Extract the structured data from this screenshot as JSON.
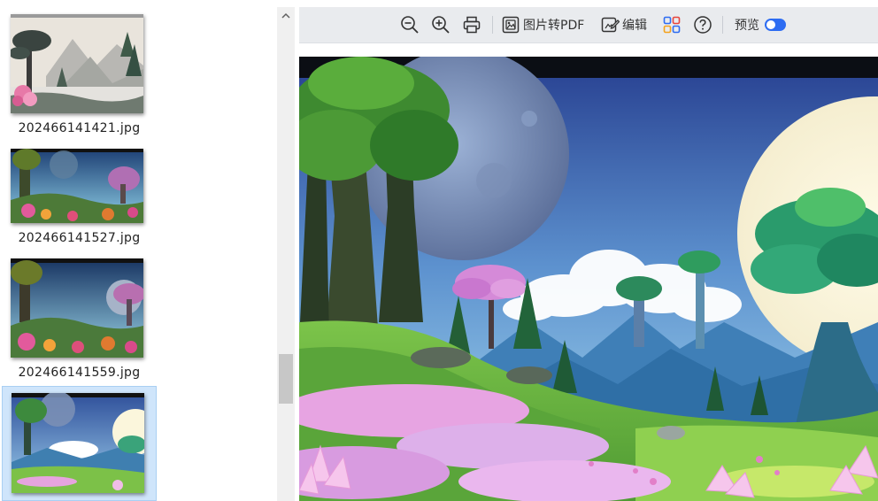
{
  "sidebar": {
    "thumbnails": [
      {
        "filename": "202466141421.jpg",
        "selected": false
      },
      {
        "filename": "202466141527.jpg",
        "selected": false
      },
      {
        "filename": "202466141559.jpg",
        "selected": false
      },
      {
        "filename": "",
        "selected": true
      }
    ]
  },
  "toolbar": {
    "zoom_out_icon": "zoom-out-icon",
    "zoom_in_icon": "zoom-in-icon",
    "print_icon": "printer-icon",
    "to_pdf_label": "图片转PDF",
    "edit_label": "编辑",
    "layout_icon": "grid-icon",
    "help_icon": "question-icon",
    "preview_label": "预览",
    "preview_toggle_on": true
  },
  "colors": {
    "accent": "#2d6cf2",
    "selection": "#cfe5fb",
    "toolbar_bg": "#e9ebee"
  }
}
